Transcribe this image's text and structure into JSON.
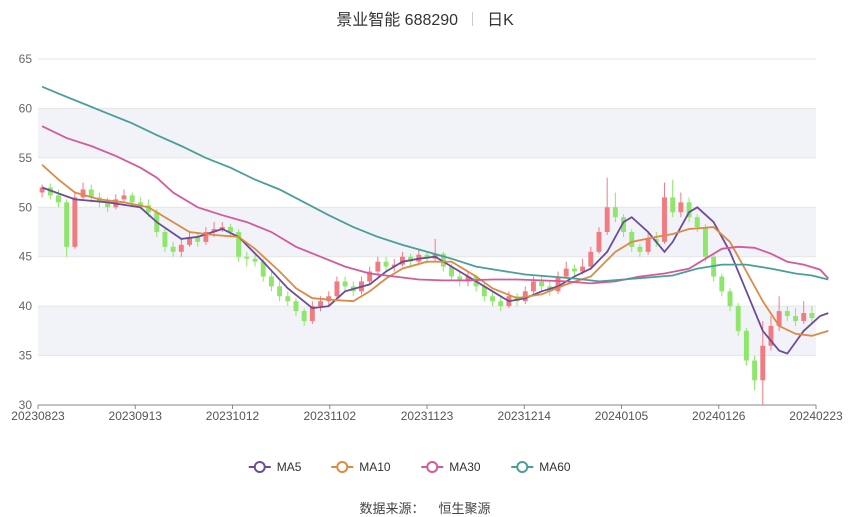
{
  "header": {
    "name": "景业智能 688290",
    "period": "日K"
  },
  "source": {
    "label": "数据来源：",
    "value": "恒生聚源"
  },
  "chart_data": {
    "type": "candlestick",
    "title": "景业智能 688290",
    "ylim": [
      30,
      65
    ],
    "y_ticks": [
      30,
      35,
      40,
      45,
      50,
      55,
      60,
      65
    ],
    "x_ticks": [
      "20230823",
      "20230913",
      "20231012",
      "20231102",
      "20231123",
      "20231214",
      "20240105",
      "20240126",
      "20240223"
    ],
    "grid": true,
    "legend_position": "bottom",
    "colors": {
      "up": "#f07c82",
      "down": "#8ee66b",
      "band": "#f2f3f8",
      "grid": "#e6e6e6"
    },
    "candles": [
      [
        51.5,
        52.0,
        52.3,
        51.0
      ],
      [
        52.0,
        51.2,
        52.4,
        50.8
      ],
      [
        51.2,
        50.5,
        51.8,
        50.0
      ],
      [
        50.5,
        46.0,
        50.8,
        45.0
      ],
      [
        46.0,
        51.0,
        51.5,
        45.8
      ],
      [
        51.0,
        51.8,
        52.5,
        50.8
      ],
      [
        51.8,
        51.0,
        52.3,
        50.5
      ],
      [
        51.0,
        50.5,
        51.5,
        50.0
      ],
      [
        50.5,
        50.0,
        51.0,
        49.5
      ],
      [
        50.0,
        50.8,
        51.3,
        49.8
      ],
      [
        50.8,
        51.2,
        51.8,
        50.5
      ],
      [
        51.2,
        50.5,
        51.5,
        50.0
      ],
      [
        50.5,
        50.2,
        51.0,
        49.8
      ],
      [
        50.2,
        49.5,
        50.8,
        49.0
      ],
      [
        49.5,
        47.5,
        49.8,
        47.0
      ],
      [
        47.5,
        46.0,
        47.8,
        45.5
      ],
      [
        46.0,
        45.5,
        46.5,
        45.0
      ],
      [
        45.5,
        46.2,
        46.8,
        45.0
      ],
      [
        46.2,
        47.0,
        47.5,
        46.0
      ],
      [
        47.0,
        46.5,
        47.5,
        46.0
      ],
      [
        46.5,
        47.5,
        48.0,
        46.2
      ],
      [
        47.5,
        47.8,
        48.5,
        47.0
      ],
      [
        47.8,
        48.0,
        48.5,
        47.5
      ],
      [
        48.0,
        47.5,
        48.3,
        47.0
      ],
      [
        47.5,
        45.0,
        47.8,
        44.5
      ],
      [
        45.0,
        44.8,
        45.5,
        44.0
      ],
      [
        44.8,
        44.5,
        45.2,
        44.0
      ],
      [
        44.5,
        43.0,
        44.8,
        42.5
      ],
      [
        43.0,
        42.0,
        43.5,
        41.5
      ],
      [
        42.0,
        41.0,
        42.5,
        40.5
      ],
      [
        41.0,
        40.5,
        41.5,
        40.0
      ],
      [
        40.5,
        39.5,
        40.8,
        39.0
      ],
      [
        39.5,
        38.5,
        39.8,
        38.0
      ],
      [
        38.5,
        40.0,
        40.5,
        38.2
      ],
      [
        40.0,
        40.5,
        41.0,
        39.5
      ],
      [
        40.5,
        41.0,
        41.5,
        40.0
      ],
      [
        41.0,
        42.5,
        43.0,
        40.8
      ],
      [
        42.5,
        42.0,
        43.0,
        41.5
      ],
      [
        42.0,
        41.5,
        42.5,
        41.0
      ],
      [
        41.5,
        42.5,
        43.0,
        41.2
      ],
      [
        42.5,
        43.5,
        44.0,
        42.2
      ],
      [
        43.5,
        44.5,
        45.0,
        43.0
      ],
      [
        44.5,
        44.0,
        45.0,
        43.5
      ],
      [
        44.0,
        44.2,
        44.8,
        43.5
      ],
      [
        44.2,
        45.0,
        45.5,
        44.0
      ],
      [
        45.0,
        44.5,
        45.3,
        44.0
      ],
      [
        44.5,
        45.2,
        45.8,
        44.2
      ],
      [
        45.2,
        44.8,
        45.5,
        44.3
      ],
      [
        44.8,
        45.3,
        46.8,
        44.5
      ],
      [
        45.3,
        44.0,
        45.5,
        43.5
      ],
      [
        44.0,
        43.0,
        44.3,
        42.5
      ],
      [
        43.0,
        42.5,
        43.5,
        42.0
      ],
      [
        42.5,
        43.0,
        43.5,
        42.0
      ],
      [
        43.0,
        42.0,
        43.2,
        41.5
      ],
      [
        42.0,
        41.0,
        42.3,
        40.5
      ],
      [
        41.0,
        40.5,
        41.5,
        40.0
      ],
      [
        40.5,
        40.0,
        41.0,
        39.5
      ],
      [
        40.0,
        41.0,
        41.5,
        39.8
      ],
      [
        41.0,
        40.5,
        41.3,
        40.0
      ],
      [
        40.5,
        41.5,
        42.0,
        40.2
      ],
      [
        41.5,
        42.5,
        43.0,
        41.2
      ],
      [
        42.5,
        42.0,
        43.0,
        41.5
      ],
      [
        42.0,
        41.5,
        42.5,
        41.0
      ],
      [
        41.5,
        43.0,
        43.5,
        41.2
      ],
      [
        43.0,
        43.8,
        44.5,
        42.8
      ],
      [
        43.8,
        43.5,
        44.2,
        43.0
      ],
      [
        43.5,
        44.0,
        44.8,
        43.2
      ],
      [
        44.0,
        45.5,
        46.0,
        43.8
      ],
      [
        45.5,
        47.5,
        48.0,
        45.3
      ],
      [
        47.5,
        50.0,
        53.0,
        47.2
      ],
      [
        50.0,
        49.0,
        51.5,
        48.5
      ],
      [
        49.0,
        47.5,
        49.3,
        47.0
      ],
      [
        47.5,
        46.0,
        47.8,
        45.5
      ],
      [
        46.0,
        45.5,
        46.3,
        45.0
      ],
      [
        45.5,
        46.8,
        47.5,
        45.2
      ],
      [
        46.8,
        46.5,
        47.5,
        46.0
      ],
      [
        46.5,
        51.0,
        52.5,
        46.3
      ],
      [
        51.0,
        49.5,
        52.8,
        49.0
      ],
      [
        49.5,
        50.5,
        51.5,
        49.0
      ],
      [
        50.5,
        49.0,
        51.0,
        48.5
      ],
      [
        49.0,
        48.0,
        49.3,
        47.5
      ],
      [
        48.0,
        45.0,
        48.3,
        44.5
      ],
      [
        45.0,
        43.0,
        45.3,
        42.5
      ],
      [
        43.0,
        41.5,
        43.3,
        41.0
      ],
      [
        41.5,
        40.0,
        41.8,
        39.5
      ],
      [
        40.0,
        37.5,
        40.3,
        37.0
      ],
      [
        37.5,
        34.5,
        37.8,
        34.0
      ],
      [
        34.5,
        32.5,
        35.0,
        31.5
      ],
      [
        32.5,
        36.0,
        38.5,
        30.0
      ],
      [
        36.0,
        38.0,
        39.0,
        35.5
      ],
      [
        38.0,
        39.5,
        41.0,
        37.5
      ],
      [
        39.5,
        39.0,
        40.0,
        38.5
      ],
      [
        39.0,
        38.5,
        39.8,
        38.0
      ],
      [
        38.5,
        39.3,
        40.5,
        38.2
      ],
      [
        39.3,
        38.8,
        40.0,
        38.3
      ]
    ],
    "series": [
      {
        "name": "MA5",
        "color": "#6b4c9a",
        "points": [
          [
            0,
            52.0
          ],
          [
            4,
            50.8
          ],
          [
            8,
            50.5
          ],
          [
            12,
            50.0
          ],
          [
            14,
            48.5
          ],
          [
            17,
            46.8
          ],
          [
            19,
            47.0
          ],
          [
            22,
            47.8
          ],
          [
            24,
            47.0
          ],
          [
            27,
            44.5
          ],
          [
            30,
            41.8
          ],
          [
            33,
            39.8
          ],
          [
            35,
            40.0
          ],
          [
            37,
            41.5
          ],
          [
            40,
            42.2
          ],
          [
            42,
            43.5
          ],
          [
            44,
            44.5
          ],
          [
            46,
            44.8
          ],
          [
            48,
            45.0
          ],
          [
            50,
            44.0
          ],
          [
            53,
            42.5
          ],
          [
            55,
            41.5
          ],
          [
            57,
            40.5
          ],
          [
            59,
            40.8
          ],
          [
            61,
            41.5
          ],
          [
            63,
            42.0
          ],
          [
            65,
            43.0
          ],
          [
            67,
            43.8
          ],
          [
            69,
            45.5
          ],
          [
            71,
            48.5
          ],
          [
            72,
            49.0
          ],
          [
            74,
            47.5
          ],
          [
            76,
            45.5
          ],
          [
            77,
            46.5
          ],
          [
            79,
            49.5
          ],
          [
            80,
            50.0
          ],
          [
            82,
            48.5
          ],
          [
            84,
            45.5
          ],
          [
            86,
            41.5
          ],
          [
            88,
            37.5
          ],
          [
            90,
            35.5
          ],
          [
            91,
            35.2
          ],
          [
            93,
            37.5
          ],
          [
            95,
            39.0
          ],
          [
            96,
            39.3
          ]
        ]
      },
      {
        "name": "MA10",
        "color": "#dd8a45",
        "points": [
          [
            0,
            54.3
          ],
          [
            2,
            52.8
          ],
          [
            4,
            51.5
          ],
          [
            7,
            50.8
          ],
          [
            10,
            50.5
          ],
          [
            13,
            50.0
          ],
          [
            16,
            48.5
          ],
          [
            18,
            47.5
          ],
          [
            21,
            47.2
          ],
          [
            24,
            47.0
          ],
          [
            26,
            45.8
          ],
          [
            29,
            43.5
          ],
          [
            31,
            41.8
          ],
          [
            33,
            40.8
          ],
          [
            36,
            40.6
          ],
          [
            38,
            40.5
          ],
          [
            40,
            41.5
          ],
          [
            42,
            42.8
          ],
          [
            44,
            43.8
          ],
          [
            47,
            44.5
          ],
          [
            50,
            44.5
          ],
          [
            53,
            43.0
          ],
          [
            55,
            41.8
          ],
          [
            58,
            40.8
          ],
          [
            61,
            41.2
          ],
          [
            64,
            42.2
          ],
          [
            67,
            43.0
          ],
          [
            70,
            45.5
          ],
          [
            72,
            46.5
          ],
          [
            75,
            47.0
          ],
          [
            77,
            47.3
          ],
          [
            79,
            47.8
          ],
          [
            82,
            48.0
          ],
          [
            84,
            46.5
          ],
          [
            86,
            43.5
          ],
          [
            88,
            40.5
          ],
          [
            90,
            38.0
          ],
          [
            92,
            37.2
          ],
          [
            94,
            37.0
          ],
          [
            96,
            37.5
          ]
        ]
      },
      {
        "name": "MA30",
        "color": "#d45a9a",
        "points": [
          [
            0,
            58.2
          ],
          [
            3,
            57.0
          ],
          [
            6,
            56.2
          ],
          [
            9,
            55.2
          ],
          [
            12,
            54.0
          ],
          [
            14,
            53.0
          ],
          [
            16,
            51.5
          ],
          [
            19,
            50.0
          ],
          [
            22,
            49.2
          ],
          [
            25,
            48.5
          ],
          [
            28,
            47.5
          ],
          [
            31,
            46.0
          ],
          [
            34,
            45.0
          ],
          [
            37,
            44.0
          ],
          [
            40,
            43.3
          ],
          [
            43,
            43.0
          ],
          [
            46,
            42.7
          ],
          [
            49,
            42.6
          ],
          [
            52,
            42.6
          ],
          [
            55,
            42.7
          ],
          [
            58,
            42.7
          ],
          [
            61,
            42.6
          ],
          [
            64,
            42.5
          ],
          [
            67,
            42.3
          ],
          [
            70,
            42.5
          ],
          [
            73,
            43.0
          ],
          [
            76,
            43.3
          ],
          [
            79,
            43.8
          ],
          [
            81,
            44.8
          ],
          [
            83,
            45.8
          ],
          [
            85,
            46.0
          ],
          [
            87,
            45.9
          ],
          [
            89,
            45.3
          ],
          [
            91,
            44.5
          ],
          [
            93,
            44.2
          ],
          [
            95,
            43.7
          ],
          [
            96,
            42.8
          ]
        ]
      },
      {
        "name": "MA60",
        "color": "#4a9e9a",
        "points": [
          [
            0,
            62.2
          ],
          [
            2,
            61.5
          ],
          [
            5,
            60.5
          ],
          [
            8,
            59.5
          ],
          [
            11,
            58.5
          ],
          [
            14,
            57.3
          ],
          [
            17,
            56.2
          ],
          [
            20,
            55.0
          ],
          [
            23,
            54.0
          ],
          [
            26,
            52.8
          ],
          [
            29,
            51.8
          ],
          [
            32,
            50.5
          ],
          [
            35,
            49.2
          ],
          [
            38,
            48.0
          ],
          [
            41,
            47.0
          ],
          [
            44,
            46.2
          ],
          [
            47,
            45.5
          ],
          [
            50,
            44.8
          ],
          [
            53,
            44.0
          ],
          [
            56,
            43.6
          ],
          [
            59,
            43.2
          ],
          [
            62,
            43.0
          ],
          [
            65,
            42.8
          ],
          [
            68,
            42.5
          ],
          [
            71,
            42.7
          ],
          [
            74,
            42.9
          ],
          [
            77,
            43.1
          ],
          [
            80,
            43.8
          ],
          [
            83,
            44.2
          ],
          [
            86,
            44.2
          ],
          [
            89,
            43.8
          ],
          [
            92,
            43.3
          ],
          [
            94,
            43.1
          ],
          [
            96,
            42.7
          ]
        ]
      }
    ]
  }
}
